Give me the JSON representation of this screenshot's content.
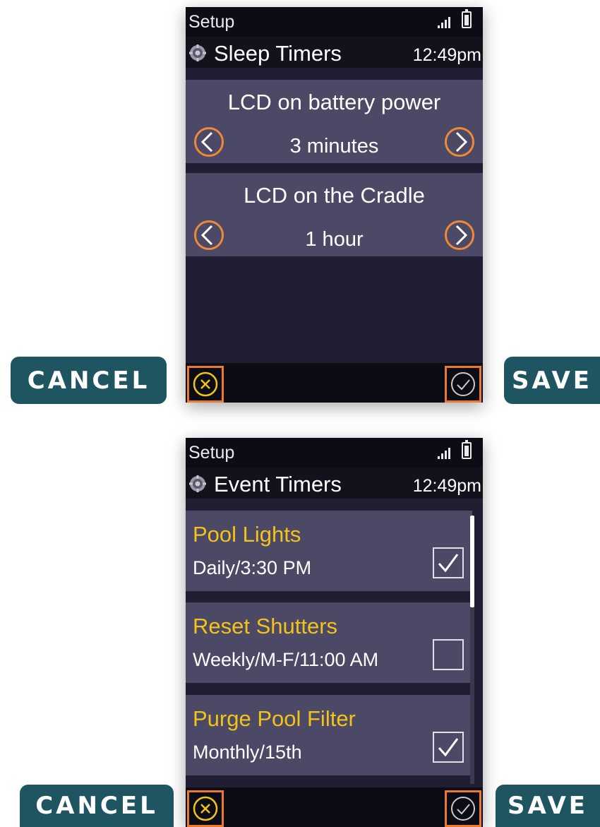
{
  "colors": {
    "accent": "#f0883a",
    "highlight": "#f3c417",
    "panel": "#4b4966",
    "background": "#1f1e33",
    "button": "#1f5560"
  },
  "screens": [
    {
      "status": {
        "app": "Setup",
        "signal_icon": "signal-bars-icon",
        "battery_icon": "battery-icon"
      },
      "title": {
        "icon": "gear-icon",
        "text": "Sleep Timers",
        "time": "12:49pm"
      },
      "settings": [
        {
          "label": "LCD on battery power",
          "value": "3 minutes"
        },
        {
          "label": "LCD on the Cradle",
          "value": "1 hour"
        }
      ],
      "footer": {
        "cancel_icon": "close-circle-icon",
        "save_icon": "check-circle-icon"
      }
    },
    {
      "status": {
        "app": "Setup",
        "signal_icon": "signal-bars-icon",
        "battery_icon": "battery-icon"
      },
      "title": {
        "icon": "gear-icon",
        "text": "Event Timers",
        "time": "12:49pm"
      },
      "events": [
        {
          "name": "Pool Lights",
          "schedule": "Daily/3:30 PM",
          "checked": true
        },
        {
          "name": "Reset Shutters",
          "schedule": "Weekly/M-F/11:00 AM",
          "checked": false
        },
        {
          "name": "Purge Pool Filter",
          "schedule": "Monthly/15th",
          "checked": true
        }
      ],
      "footer": {
        "cancel_icon": "close-circle-icon",
        "save_icon": "check-circle-icon"
      }
    }
  ],
  "buttons": {
    "cancel": "CANCEL",
    "save": "SAVE"
  }
}
